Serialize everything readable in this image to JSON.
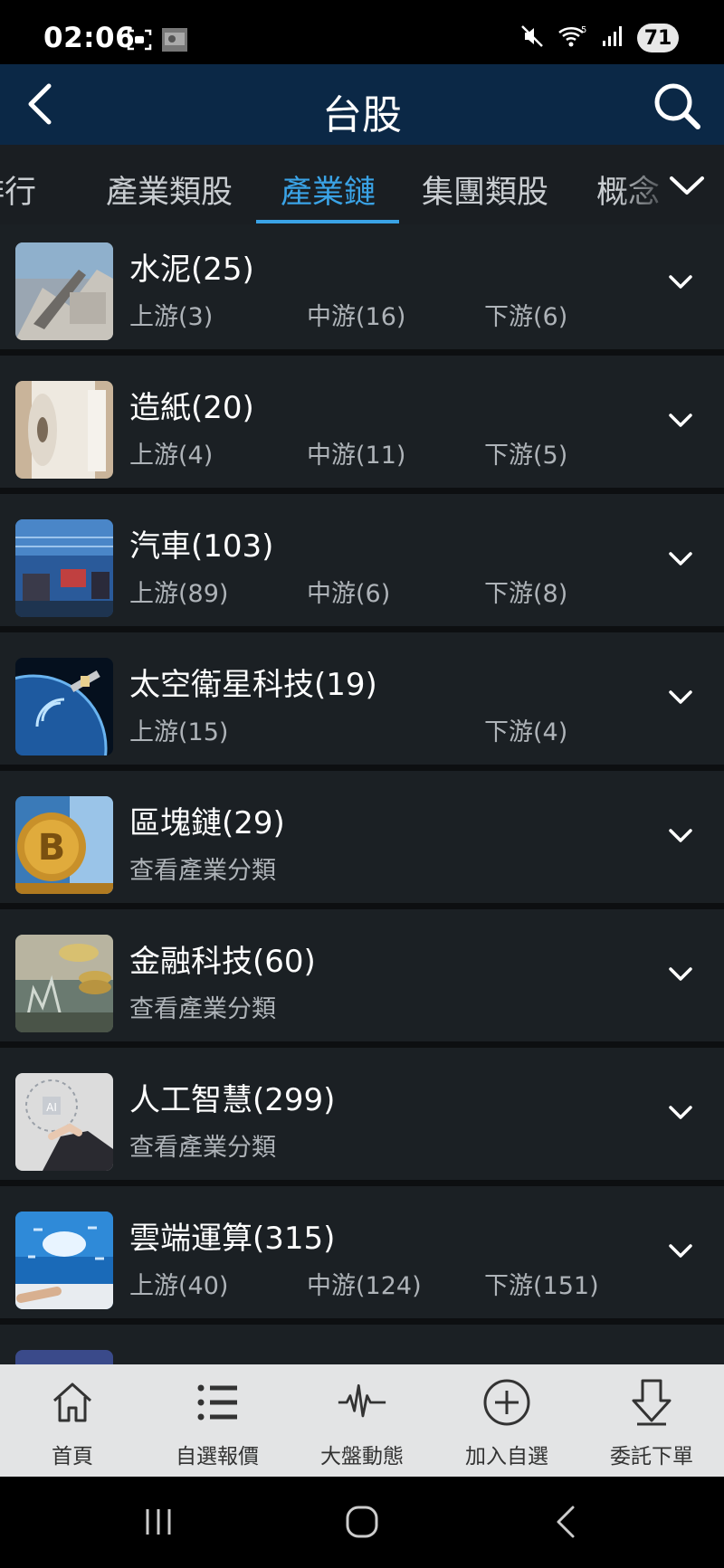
{
  "status_bar": {
    "time": "02:06",
    "battery": "71",
    "icons": [
      "screenshot-icon",
      "gallery-thumbnail-icon",
      "mute-icon",
      "wifi-icon",
      "signal-icon"
    ]
  },
  "header": {
    "title": "台股",
    "back_icon": "chevron-left-icon",
    "search_icon": "search-icon"
  },
  "tabs": [
    {
      "label": "排行",
      "active": false
    },
    {
      "label": "產業類股",
      "active": false
    },
    {
      "label": "產業鏈",
      "active": true
    },
    {
      "label": "集團類股",
      "active": false
    },
    {
      "label": "概念",
      "active": false
    }
  ],
  "colors": {
    "accent": "#3aa3e6",
    "header_bg": "#0b2846",
    "list_bg": "#1b2024",
    "bottom_nav_bg": "#e3e4e5"
  },
  "industries": [
    {
      "title": "水泥(25)",
      "image": "cement-plant-image",
      "upstream": "上游(3)",
      "midstream": "中游(16)",
      "downstream": "下游(6)",
      "view_link": ""
    },
    {
      "title": "造紙(20)",
      "image": "paper-roll-image",
      "upstream": "上游(4)",
      "midstream": "中游(11)",
      "downstream": "下游(5)",
      "view_link": ""
    },
    {
      "title": "汽車(103)",
      "image": "car-factory-image",
      "upstream": "上游(89)",
      "midstream": "中游(6)",
      "downstream": "下游(8)",
      "view_link": ""
    },
    {
      "title": "太空衛星科技(19)",
      "image": "satellite-earth-image",
      "upstream": "上游(15)",
      "midstream": "",
      "downstream": "下游(4)",
      "view_link": ""
    },
    {
      "title": "區塊鏈(29)",
      "image": "bitcoin-image",
      "upstream": "",
      "midstream": "",
      "downstream": "",
      "view_link": "查看產業分類"
    },
    {
      "title": "金融科技(60)",
      "image": "coins-finance-image",
      "upstream": "",
      "midstream": "",
      "downstream": "",
      "view_link": "查看產業分類"
    },
    {
      "title": "人工智慧(299)",
      "image": "ai-hand-image",
      "upstream": "",
      "midstream": "",
      "downstream": "",
      "view_link": "查看產業分類"
    },
    {
      "title": "雲端運算(315)",
      "image": "cloud-computing-image",
      "upstream": "上游(40)",
      "midstream": "中游(124)",
      "downstream": "下游(151)",
      "view_link": ""
    }
  ],
  "bottom_nav": [
    {
      "label": "首頁",
      "icon": "home-icon"
    },
    {
      "label": "自選報價",
      "icon": "list-icon"
    },
    {
      "label": "大盤動態",
      "icon": "pulse-icon"
    },
    {
      "label": "加入自選",
      "icon": "add-circle-icon"
    },
    {
      "label": "委託下單",
      "icon": "order-down-icon"
    }
  ],
  "system_nav": [
    "recents-icon",
    "home-circle-icon",
    "back-icon"
  ]
}
